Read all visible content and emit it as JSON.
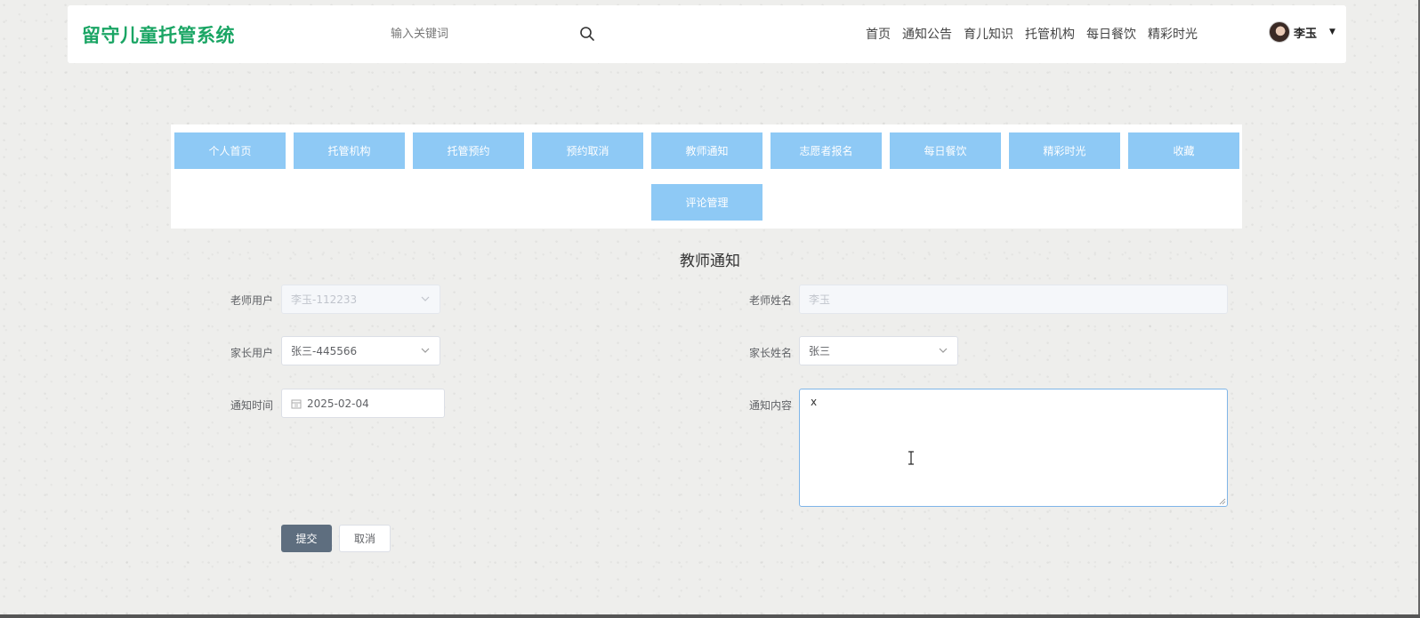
{
  "header": {
    "logo": "留守儿童托管系统",
    "search_placeholder": "输入关键词",
    "nav": [
      "首页",
      "通知公告",
      "育儿知识",
      "托管机构",
      "每日餐饮",
      "精彩时光"
    ],
    "user_name": "李玉"
  },
  "menu": {
    "row1": [
      "个人首页",
      "托管机构",
      "托管预约",
      "预约取消",
      "教师通知",
      "志愿者报名",
      "每日餐饮",
      "精彩时光",
      "收藏"
    ],
    "row2": [
      "评论管理"
    ]
  },
  "form": {
    "title": "教师通知",
    "teacher_user": {
      "label": "老师用户",
      "value": "李玉-112233"
    },
    "teacher_name": {
      "label": "老师姓名",
      "value": "李玉"
    },
    "parent_user": {
      "label": "家长用户",
      "value": "张三-445566"
    },
    "parent_name": {
      "label": "家长姓名",
      "value": "张三"
    },
    "notify_time": {
      "label": "通知时间",
      "value": "2025-02-04"
    },
    "notify_content": {
      "label": "通知内容",
      "value": "x"
    },
    "submit_label": "提交",
    "cancel_label": "取消"
  },
  "colors": {
    "logo": "#1aa564",
    "menu_button": "#8ec9f5",
    "submit_button": "#5e6e7f",
    "textarea_focus_border": "#7fb5e8"
  }
}
